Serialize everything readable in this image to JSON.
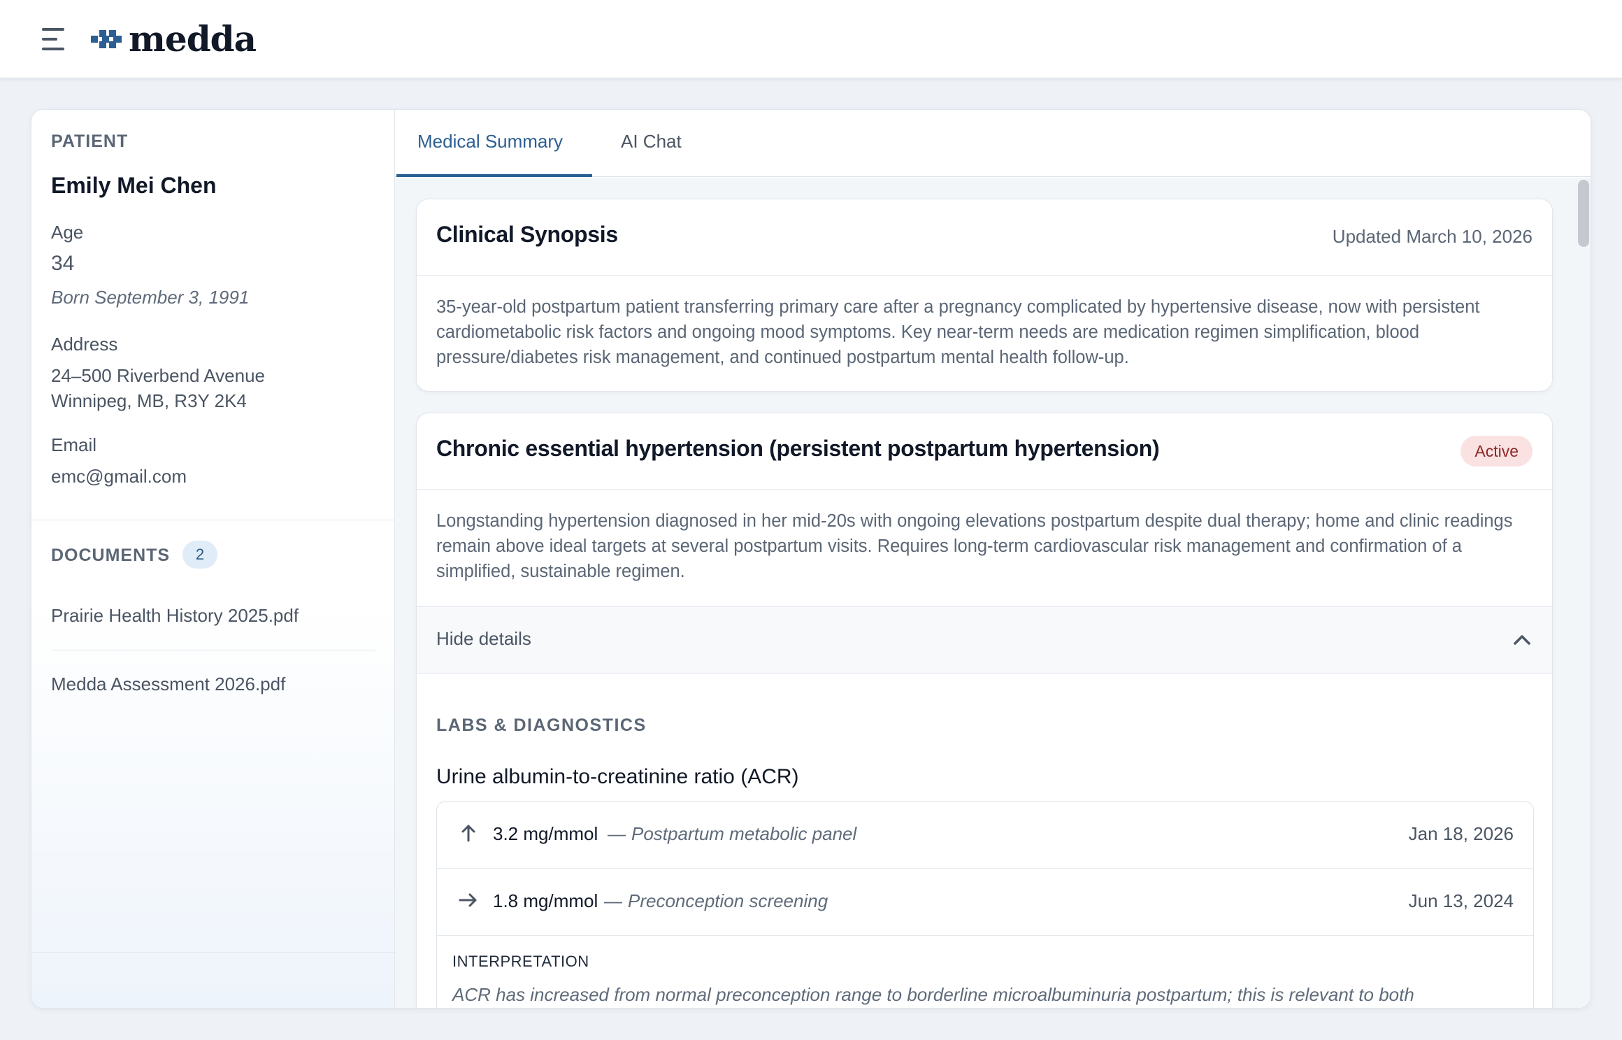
{
  "app": {
    "logo_text": "medda"
  },
  "sidebar": {
    "patient_label": "PATIENT",
    "name": "Emily Mei Chen",
    "age_label": "Age",
    "age_value": "34",
    "birth": "Born September 3, 1991",
    "address_label": "Address",
    "address_line1": "24–500 Riverbend Avenue",
    "address_line2": "Winnipeg, MB, R3Y 2K4",
    "email_label": "Email",
    "email_value": "emc@gmail.com",
    "documents_label": "DOCUMENTS",
    "documents_count": "2",
    "documents": [
      {
        "name": "Prairie Health History 2025.pdf"
      },
      {
        "name": "Medda Assessment 2026.pdf"
      }
    ]
  },
  "tabs": [
    {
      "label": "Medical Summary",
      "active": true
    },
    {
      "label": "AI Chat",
      "active": false
    }
  ],
  "synopsis": {
    "title": "Clinical Synopsis",
    "updated": "Updated March 10, 2026",
    "text": "35-year-old postpartum patient transferring primary care after a pregnancy complicated by hypertensive disease, now with persistent cardiometabolic risk factors and ongoing mood symptoms. Key near-term needs are medication regimen simplification, blood pressure/diabetes risk management, and continued postpartum mental health follow-up."
  },
  "condition": {
    "title": "Chronic essential hypertension (persistent postpartum hypertension)",
    "status": "Active",
    "status_color": "#fbe2e2",
    "description": "Longstanding hypertension diagnosed in her mid-20s with ongoing elevations postpartum despite dual therapy; home and clinic readings remain above ideal targets at several postpartum visits. Requires long-term cardiovascular risk management and confirmation of a simplified, sustainable regimen.",
    "details_toggle": "Hide details",
    "labs_section_label": "LABS & DIAGNOSTICS",
    "lab": {
      "name": "Urine albumin-to-creatinine ratio (ACR)",
      "results": [
        {
          "trend_icon": "arrow-up-icon",
          "value": "3.2 mg/mmol",
          "separator": "—",
          "source": "Postpartum metabolic panel",
          "date": "Jan 18, 2026"
        },
        {
          "trend_icon": "arrow-right-icon",
          "value": "1.8 mg/mmol",
          "separator": "—",
          "source": "Preconception screening",
          "date": "Jun 13, 2024"
        }
      ],
      "interpretation_label": "INTERPRETATION",
      "interpretation_text": "ACR has increased from normal preconception range to borderline microalbuminuria postpartum; this is relevant to both"
    }
  },
  "colors": {
    "accent": "#2b5f93",
    "background": "#eef2f7"
  }
}
